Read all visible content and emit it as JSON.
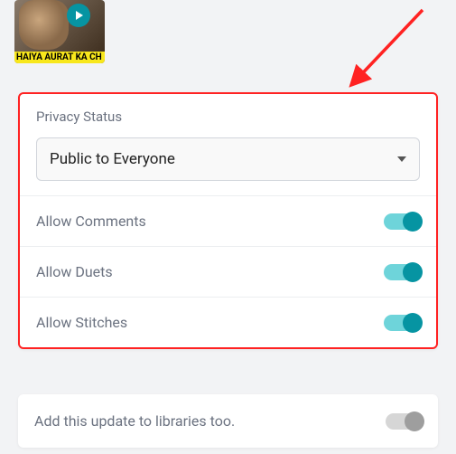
{
  "thumbnail": {
    "caption": "HAIYA AURAT KA CH"
  },
  "privacy": {
    "status_label": "Privacy Status",
    "select_value": "Public to Everyone",
    "options": {
      "allow_comments": {
        "label": "Allow Comments",
        "enabled": true
      },
      "allow_duets": {
        "label": "Allow Duets",
        "enabled": true
      },
      "allow_stitches": {
        "label": "Allow Stitches",
        "enabled": true
      }
    }
  },
  "libraries": {
    "label": "Add this update to libraries too.",
    "enabled": false
  },
  "colors": {
    "accent": "#0694a2",
    "highlight_border": "#ff2222"
  }
}
